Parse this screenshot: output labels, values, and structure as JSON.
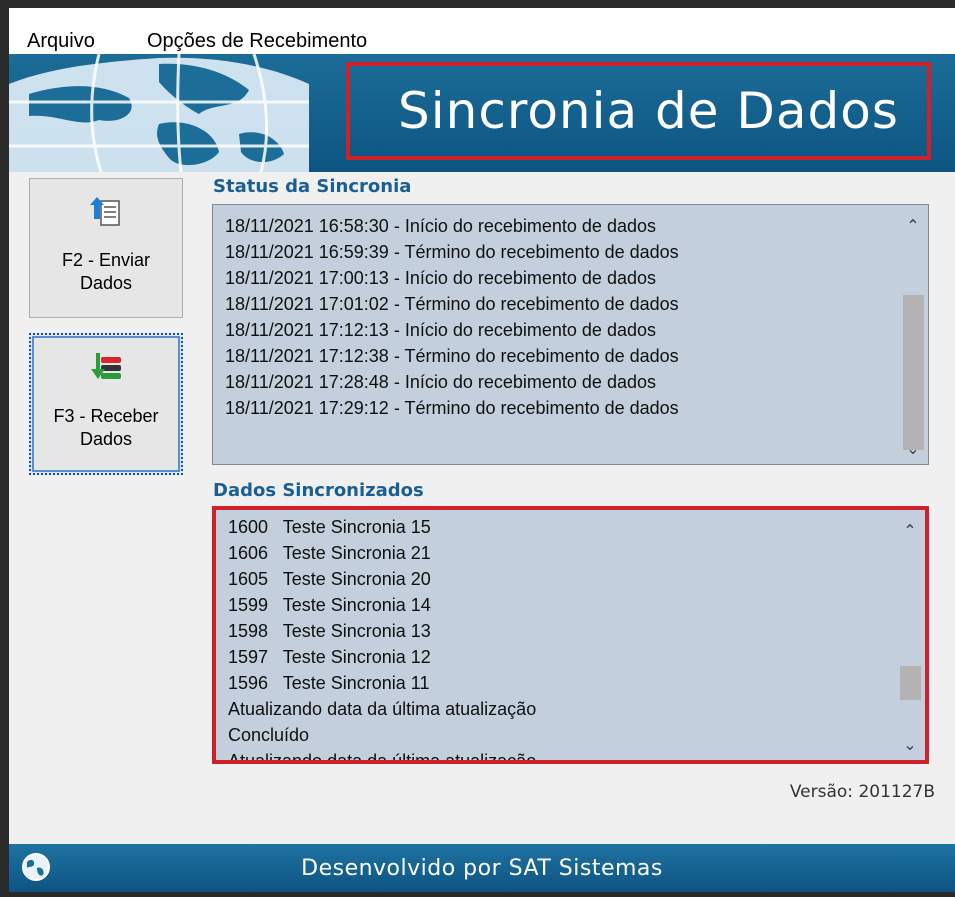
{
  "menu": {
    "items": [
      {
        "label": "Arquivo"
      },
      {
        "label": "Opções de Recebimento"
      }
    ]
  },
  "banner": {
    "title": "Sincronia de Dados"
  },
  "sidebar": {
    "send_button": {
      "label_line1": "F2 - Enviar",
      "label_line2": "Dados",
      "icon": "upload-document-icon"
    },
    "receive_button": {
      "label_line1": "F3 - Receber",
      "label_line2": "Dados",
      "icon": "download-database-icon"
    }
  },
  "status": {
    "label": "Status da Sincronia",
    "lines": [
      "18/11/2021 16:58:30 - Início do recebimento de dados",
      "18/11/2021 16:59:39 - Término do recebimento de dados",
      "18/11/2021 17:00:13 - Início do recebimento de dados",
      "18/11/2021 17:01:02 - Término do recebimento de dados",
      "18/11/2021 17:12:13 - Início do recebimento de dados",
      "18/11/2021 17:12:38 - Término do recebimento de dados",
      "18/11/2021 17:28:48 - Início do recebimento de dados",
      "18/11/2021 17:29:12 - Término do recebimento de dados"
    ]
  },
  "synced": {
    "label": "Dados Sincronizados",
    "lines": [
      "1600   Teste Sincronia 15",
      "1606   Teste Sincronia 21",
      "1605   Teste Sincronia 20",
      "1599   Teste Sincronia 14",
      "1598   Teste Sincronia 13",
      "1597   Teste Sincronia 12",
      "1596   Teste Sincronia 11",
      "Atualizando data da última atualização",
      "Concluído",
      "Atualizando data da última atualização"
    ]
  },
  "version": "Versão: 201127B",
  "footer": {
    "text": "Desenvolvido por SAT Sistemas"
  },
  "colors": {
    "banner_blue": "#0d5482",
    "panel_bg": "#c3cfdc",
    "highlight_red": "#d0202a",
    "section_label": "#1a5e94"
  }
}
